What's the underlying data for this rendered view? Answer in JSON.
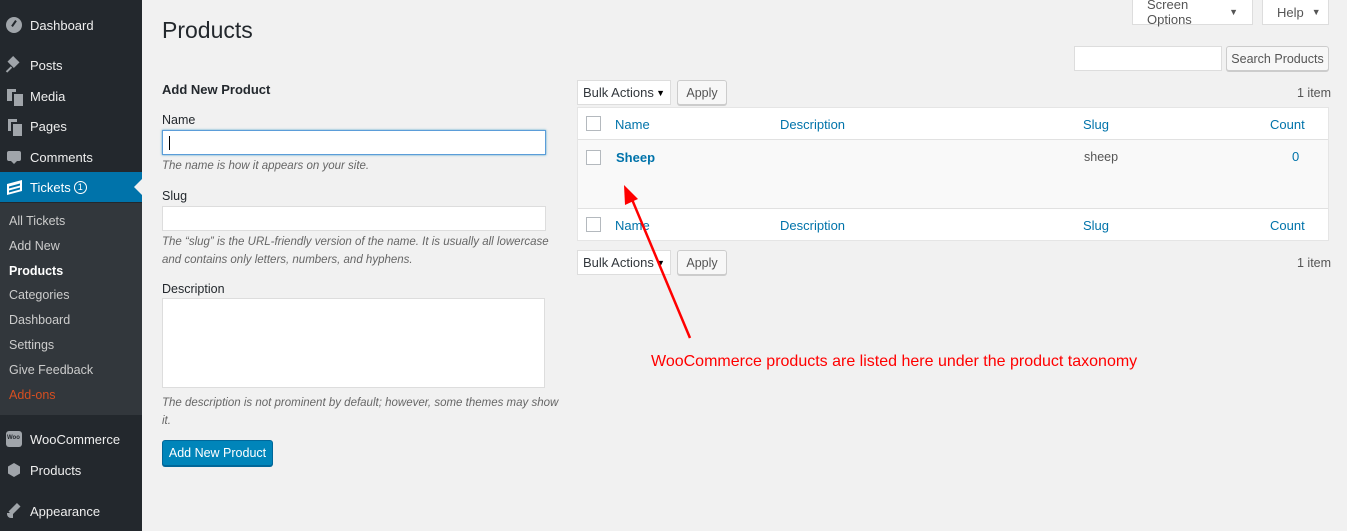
{
  "sidebar": {
    "items": [
      {
        "label": "Dashboard",
        "icon": "dashboard-icon"
      },
      {
        "label": "Posts",
        "icon": "pin-icon"
      },
      {
        "label": "Media",
        "icon": "media-icon"
      },
      {
        "label": "Pages",
        "icon": "pages-icon"
      },
      {
        "label": "Comments",
        "icon": "comments-icon"
      },
      {
        "label": "Tickets",
        "icon": "tickets-icon",
        "badge": "1"
      },
      {
        "label": "WooCommerce",
        "icon": "woocommerce-icon"
      },
      {
        "label": "Products",
        "icon": "box-icon"
      },
      {
        "label": "Appearance",
        "icon": "brush-icon"
      }
    ],
    "submenu": [
      {
        "label": "All Tickets"
      },
      {
        "label": "Add New"
      },
      {
        "label": "Products"
      },
      {
        "label": "Categories"
      },
      {
        "label": "Dashboard"
      },
      {
        "label": "Settings"
      },
      {
        "label": "Give Feedback"
      },
      {
        "label": "Add-ons"
      }
    ]
  },
  "header": {
    "title": "Products",
    "screen_options": "Screen Options",
    "help": "Help"
  },
  "search": {
    "value": "",
    "button": "Search Products"
  },
  "form": {
    "title": "Add New Product",
    "name_label": "Name",
    "name_value": "",
    "name_help": "The name is how it appears on your site.",
    "slug_label": "Slug",
    "slug_value": "",
    "slug_help": "The “slug” is the URL-friendly version of the name. It is usually all lowercase and contains only letters, numbers, and hyphens.",
    "description_label": "Description",
    "description_value": "",
    "description_help": "The description is not prominent by default; however, some themes may show it.",
    "submit": "Add New Product"
  },
  "list": {
    "bulk_actions": "Bulk Actions",
    "apply": "Apply",
    "count": "1 item",
    "columns": [
      "Name",
      "Description",
      "Slug",
      "Count"
    ],
    "rows": [
      {
        "name": "Sheep",
        "description": "",
        "slug": "sheep",
        "count": "0"
      }
    ]
  },
  "annotation": {
    "text": "WooCommerce products are listed here under the product taxonomy",
    "color": "#ff0000"
  },
  "colors": {
    "sidebar_bg": "#23282d",
    "submenu_bg": "#32373c",
    "accent": "#0073aa",
    "primary_button": "#0085ba",
    "addons": "#d54e21"
  }
}
